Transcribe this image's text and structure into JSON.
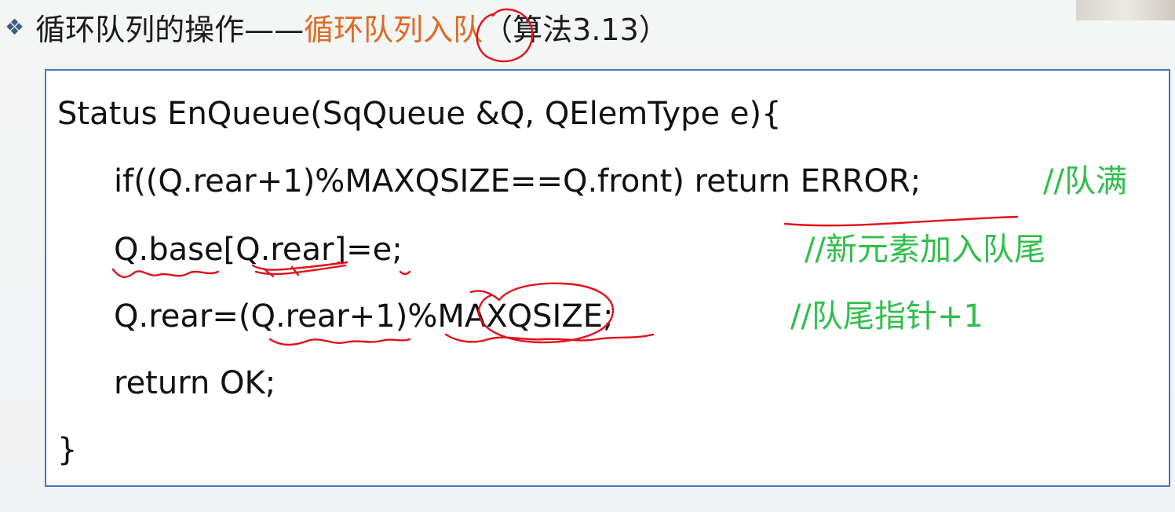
{
  "slide": {
    "bullet_icon": "diamond-bullet-icon",
    "title_part1": "循环队列的操作——",
    "title_accent": "循环队列入队",
    "title_part2": "（算法3.13）",
    "accent_color": "#de6a25"
  },
  "code": {
    "lines": [
      "Status EnQueue(SqQueue &Q, QElemType e){",
      "if((Q.rear+1)%MAXQSIZE==Q.front)  return ERROR;",
      "Q.base[Q.rear]=e;",
      "Q.rear=(Q.rear+1)%MAXQSIZE;",
      "return OK;",
      "}"
    ],
    "comments": [
      "//队满",
      "//新元素加入队尾",
      "//队尾指针+1"
    ],
    "comment_color": "#2fbf4a"
  },
  "annotations": {
    "ink_color": "#e0101a"
  }
}
